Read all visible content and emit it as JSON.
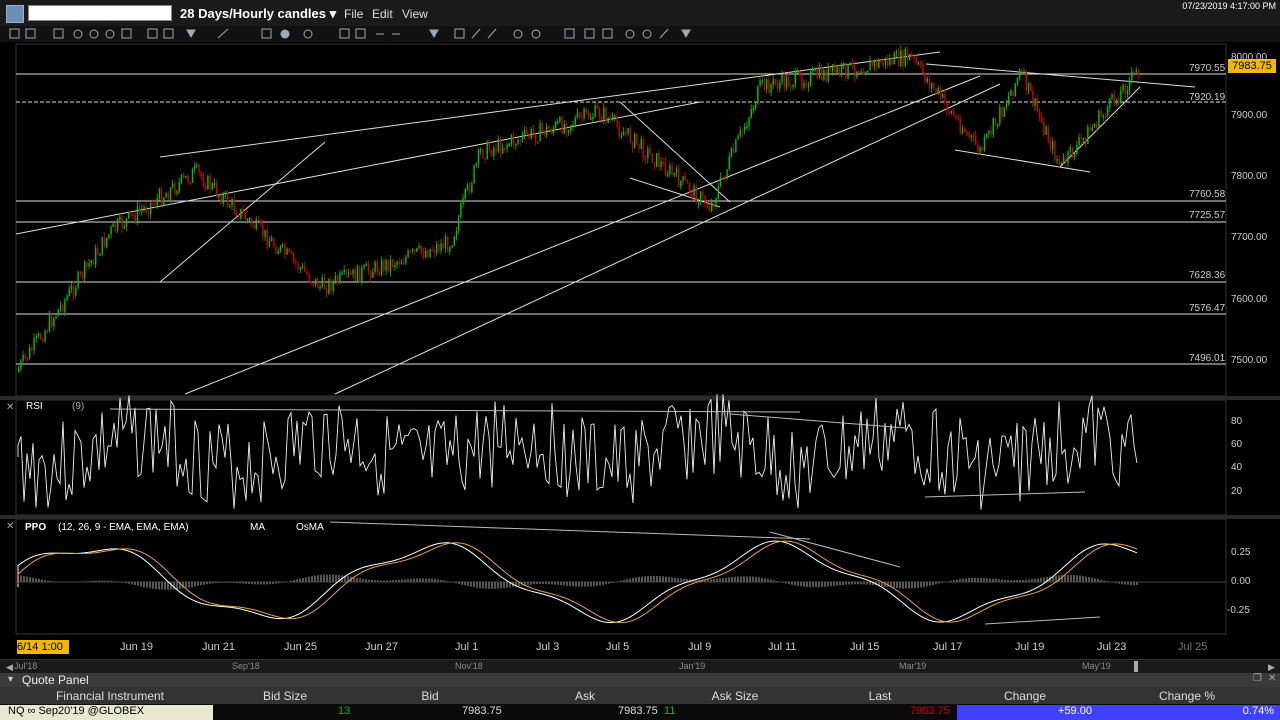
{
  "window": {
    "symbol_value": "",
    "period": "28 Days/Hourly candles ▾",
    "menus": [
      "File",
      "Edit",
      "View"
    ],
    "datetime": "07/23/2019 4:17:00 PM"
  },
  "price_levels": {
    "last_tag": "7983.75",
    "h_lines": [
      "7970.55",
      "7920.19",
      "7760.58",
      "7725.57",
      "7628.36",
      "7576.47",
      "7496.01"
    ],
    "scale_ticks": [
      "8000.00",
      "7900.00",
      "7800.00",
      "7700.00",
      "7600.00",
      "7500.00"
    ]
  },
  "rsi": {
    "label": "RSI",
    "params": "(9)",
    "ticks": [
      "80",
      "60",
      "40",
      "20"
    ]
  },
  "ppo": {
    "label": "PPO",
    "params": "(12, 26, 9 - EMA, EMA, EMA)",
    "ma_label": "MA",
    "osma_label": "OsMA",
    "ticks": [
      "0.25",
      "0.00",
      "-0.25"
    ]
  },
  "time_axis": {
    "start": "6/14 1:00",
    "labels": [
      "Jun 19",
      "Jun 21",
      "Jun 25",
      "Jun 27",
      "Jul 1",
      "Jul 3",
      "Jul 5",
      "Jul 9",
      "Jul 11",
      "Jul 15",
      "Jul 17",
      "Jul 19",
      "Jul 23",
      "Jul 25"
    ]
  },
  "overview_axis": {
    "labels": [
      "Jul'18",
      "Sep'18",
      "Nov'18",
      "Jan'19",
      "Mar'19",
      "May'19"
    ]
  },
  "quote_panel": {
    "title": "Quote Panel",
    "columns": [
      "Financial Instrument",
      "Bid Size",
      "Bid",
      "Ask",
      "Ask Size",
      "Last",
      "Change",
      "Change %"
    ],
    "row": {
      "instrument": "NQ ∞ Sep20'19 @GLOBEX",
      "bid_size": "13",
      "bid": "7983.75",
      "ask": "7983.75",
      "ask_size": "11",
      "last": "7983.75",
      "change": "+59.00",
      "change_pct": "0.74%"
    }
  },
  "colors": {
    "accent": "#f0b800",
    "up": "#00c000",
    "down": "#d00000",
    "pos_change": "#4040ff"
  }
}
